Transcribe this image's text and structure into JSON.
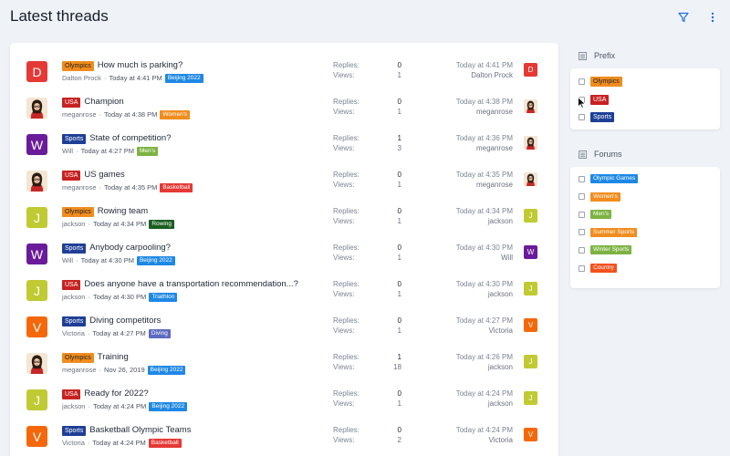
{
  "header": {
    "title": "Latest threads",
    "filter_icon": "filter-icon",
    "more_icon": "more-vertical-icon"
  },
  "labels": {
    "replies": "Replies:",
    "views": "Views:"
  },
  "colors": {
    "tag_beijing": "#1e88e5",
    "tag_women": "#f08d1e",
    "tag_men": "#7cb342",
    "tag_basketball": "#e53935",
    "tag_rowing": "#1b5e20",
    "tag_triathlon": "#1e88e5",
    "tag_diving": "#5c6bc0"
  },
  "threads": [
    {
      "avatar_letter": "D",
      "avatar_color": "#e53935",
      "prefix": "Olympics",
      "title": "How much is parking?",
      "author": "Dalton Prock",
      "time": "Today at 4:41 PM",
      "tag": "Beijing 2022",
      "tag_color": "#1e88e5",
      "replies": "0",
      "views": "1",
      "last_time": "Today at 4:41 PM",
      "last_user": "Dalton Prock",
      "mini_avatar_letter": "D",
      "mini_avatar_color": "#e53935"
    },
    {
      "avatar_letter": "",
      "avatar_color": "#f3e6d2",
      "avatar_photo": true,
      "prefix": "USA",
      "title": "Champion",
      "author": "meganrose",
      "time": "Today at 4:38 PM",
      "tag": "Women's",
      "tag_color": "#f08d1e",
      "replies": "0",
      "views": "1",
      "last_time": "Today at 4:38 PM",
      "last_user": "meganrose",
      "mini_avatar_letter": "",
      "mini_avatar_color": "#f3e6d2",
      "mini_photo": true
    },
    {
      "avatar_letter": "W",
      "avatar_color": "#6a1b9a",
      "prefix": "Sports",
      "title": "State of competition?",
      "author": "Will",
      "time": "Today at 4:27 PM",
      "tag": "Men's",
      "tag_color": "#7cb342",
      "replies": "1",
      "views": "3",
      "last_time": "Today at 4:36 PM",
      "last_user": "meganrose",
      "mini_avatar_letter": "",
      "mini_avatar_color": "#f3e6d2",
      "mini_photo": true
    },
    {
      "avatar_letter": "",
      "avatar_color": "#f3e6d2",
      "avatar_photo": true,
      "prefix": "USA",
      "title": "US games",
      "author": "meganrose",
      "time": "Today at 4:35 PM",
      "tag": "Basketball",
      "tag_color": "#e53935",
      "replies": "0",
      "views": "1",
      "last_time": "Today at 4:35 PM",
      "last_user": "meganrose",
      "mini_avatar_letter": "",
      "mini_avatar_color": "#f3e6d2",
      "mini_photo": true
    },
    {
      "avatar_letter": "J",
      "avatar_color": "#c0ca33",
      "prefix": "Olympics",
      "title": "Rowing team",
      "author": "jackson",
      "time": "Today at 4:34 PM",
      "tag": "Rowing",
      "tag_color": "#1b5e20",
      "replies": "0",
      "views": "1",
      "last_time": "Today at 4:34 PM",
      "last_user": "jackson",
      "mini_avatar_letter": "J",
      "mini_avatar_color": "#c0ca33"
    },
    {
      "avatar_letter": "W",
      "avatar_color": "#6a1b9a",
      "prefix": "Sports",
      "title": "Anybody carpooling?",
      "author": "Will",
      "time": "Today at 4:30 PM",
      "tag": "Beijing 2022",
      "tag_color": "#1e88e5",
      "replies": "0",
      "views": "1",
      "last_time": "Today at 4:30 PM",
      "last_user": "Will",
      "mini_avatar_letter": "W",
      "mini_avatar_color": "#6a1b9a"
    },
    {
      "avatar_letter": "J",
      "avatar_color": "#c0ca33",
      "prefix": "USA",
      "title": "Does anyone have a transportation recommendation...?",
      "author": "jackson",
      "time": "Today at 4:30 PM",
      "tag": "Triathlon",
      "tag_color": "#1e88e5",
      "replies": "0",
      "views": "1",
      "last_time": "Today at 4:30 PM",
      "last_user": "jackson",
      "mini_avatar_letter": "J",
      "mini_avatar_color": "#c0ca33"
    },
    {
      "avatar_letter": "V",
      "avatar_color": "#f4680b",
      "prefix": "Sports",
      "title": "Diving competitors",
      "author": "Victoria",
      "time": "Today at 4:27 PM",
      "tag": "Diving",
      "tag_color": "#5c6bc0",
      "replies": "0",
      "views": "1",
      "last_time": "Today at 4:27 PM",
      "last_user": "Victoria",
      "mini_avatar_letter": "V",
      "mini_avatar_color": "#f4680b"
    },
    {
      "avatar_letter": "",
      "avatar_color": "#f3e6d2",
      "avatar_photo": true,
      "prefix": "Olympics",
      "title": "Training",
      "author": "meganrose",
      "time": "Nov 26, 2019",
      "tag": "Beijing 2022",
      "tag_color": "#1e88e5",
      "replies": "1",
      "views": "18",
      "last_time": "Today at 4:26 PM",
      "last_user": "jackson",
      "mini_avatar_letter": "J",
      "mini_avatar_color": "#c0ca33"
    },
    {
      "avatar_letter": "J",
      "avatar_color": "#c0ca33",
      "prefix": "USA",
      "title": "Ready for 2022?",
      "author": "jackson",
      "time": "Today at 4:24 PM",
      "tag": "Beijing 2022",
      "tag_color": "#1e88e5",
      "replies": "0",
      "views": "1",
      "last_time": "Today at 4:24 PM",
      "last_user": "jackson",
      "mini_avatar_letter": "J",
      "mini_avatar_color": "#c0ca33"
    },
    {
      "avatar_letter": "V",
      "avatar_color": "#f4680b",
      "prefix": "Sports",
      "title": "Basketball Olympic Teams",
      "author": "Victoria",
      "time": "Today at 4:24 PM",
      "tag": "Basketball",
      "tag_color": "#e53935",
      "replies": "0",
      "views": "2",
      "last_time": "Today at 4:24 PM",
      "last_user": "Victoria",
      "mini_avatar_letter": "V",
      "mini_avatar_color": "#f4680b"
    }
  ],
  "prefix_filter": {
    "heading": "Prefix",
    "items": [
      {
        "label": "Olympics",
        "color": "#f08d1e",
        "text_color": "#1f1f1f"
      },
      {
        "label": "USA",
        "color": "#c82121",
        "text_color": "#ffffff"
      },
      {
        "label": "Sports",
        "color": "#1f3f96",
        "text_color": "#ffffff"
      }
    ]
  },
  "forums_filter": {
    "heading": "Forums",
    "items": [
      {
        "label": "Olympic Games",
        "color": "#1e88e5"
      },
      {
        "label": "Women's",
        "color": "#f08d1e"
      },
      {
        "label": "Men's",
        "color": "#7cb342"
      },
      {
        "label": "Summer Sports",
        "color": "#f08d1e"
      },
      {
        "label": "Winter Sports",
        "color": "#7cb342"
      },
      {
        "label": "Country",
        "color": "#f4511e"
      }
    ]
  }
}
